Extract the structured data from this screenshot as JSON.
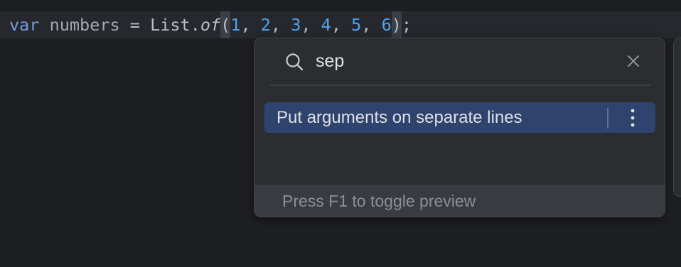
{
  "editor": {
    "code": {
      "keyword": "var",
      "variable": "numbers",
      "assign": " = ",
      "class_name": "List.",
      "method": "of",
      "open_paren": "(",
      "args": [
        "1",
        "2",
        "3",
        "4",
        "5",
        "6"
      ],
      "separator": ", ",
      "close_paren": ")",
      "terminator": ";"
    }
  },
  "popup": {
    "search": {
      "value": "sep",
      "icon": "search-icon"
    },
    "close_icon": "close-icon",
    "actions": [
      {
        "label": "Put arguments on separate lines",
        "selected": true
      }
    ],
    "more_icon": "vertical-ellipsis-icon",
    "footer": "Press F1 to toggle preview"
  },
  "colors": {
    "background": "#1e1f22",
    "current_line": "#26282e",
    "popup_bg": "#2b2d30",
    "selected_bg": "#2e436e",
    "keyword": "#6f9ee0",
    "number": "#4fa4ee",
    "footer_bg": "#393b40"
  }
}
